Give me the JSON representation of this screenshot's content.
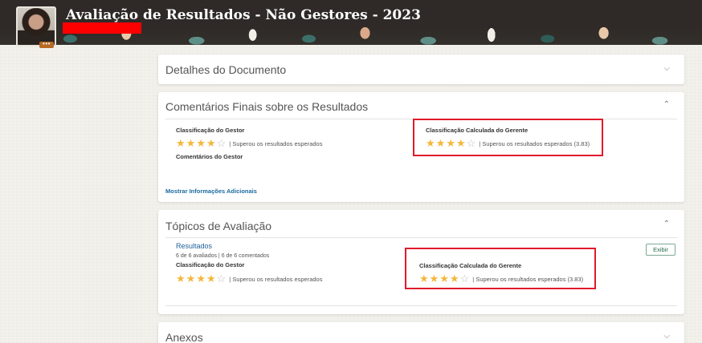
{
  "header": {
    "title": "Avaliação de Resultados - Não Gestores - 2023",
    "avatar_badge": "•••"
  },
  "cards": {
    "document": {
      "title": "Detalhes do Documento"
    },
    "final_comments": {
      "title": "Comentários Finais sobre os Resultados",
      "manager_rating_label": "Classificação do Gestor",
      "manager_rating_value": 4,
      "manager_rating_max": 5,
      "manager_rating_text": "| Superou os resultados esperados",
      "calc_rating_label": "Classificação Calculada do Gerente",
      "calc_rating_value": 4,
      "calc_rating_max": 5,
      "calc_rating_text": "| Superou os resultados esperados (3.83)",
      "manager_comments_label": "Comentários do Gestor",
      "more_info_link": "Mostrar Informações Adicionais"
    },
    "topics": {
      "title": "Tópicos de Avaliação",
      "section_link": "Resultados",
      "counts": "6 de 6 avaliados | 6 de 6 comentados",
      "view_button": "Exibir",
      "manager_rating_label": "Classificação do Gestor",
      "manager_rating_value": 4,
      "manager_rating_text": "| Superou os resultados esperados",
      "calc_rating_label": "Classificação Calculada do Gerente",
      "calc_rating_value": 4,
      "calc_rating_text": "| Superou os resultados esperados (3.83)"
    },
    "attachments": {
      "title": "Anexos"
    }
  },
  "colors": {
    "star_on": "#f3b73a",
    "star_off": "#bdbdbd",
    "highlight": "#e01a2a",
    "header_bg": "#2f2a27"
  },
  "icons": {
    "chevron_down": "chevron-down-icon",
    "chevron_up": "chevron-up-icon",
    "star": "star-icon"
  }
}
